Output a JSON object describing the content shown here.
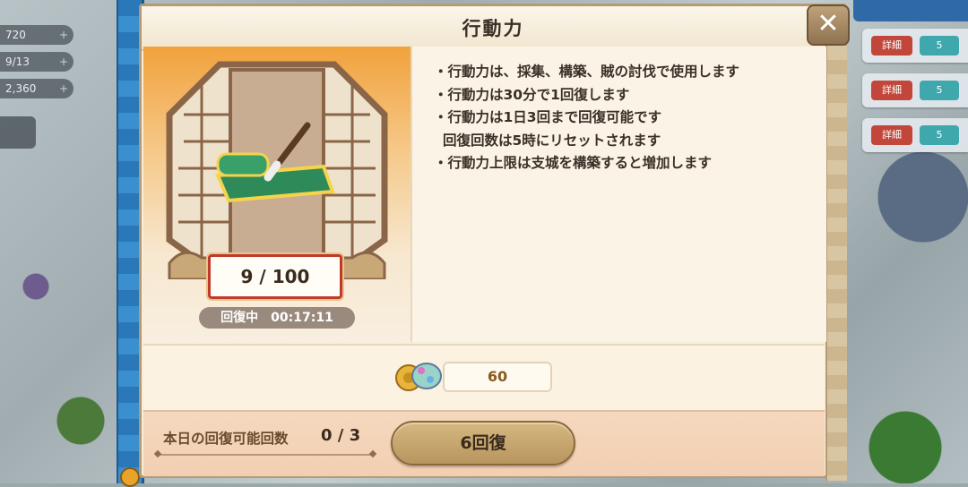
{
  "hud": {
    "resources": [
      "720",
      "9/13",
      "2,360"
    ],
    "plus": "+"
  },
  "right_panel": {
    "cards": [
      {
        "red": "詳細",
        "teal": "5"
      },
      {
        "red": "詳細",
        "teal": "5"
      },
      {
        "red": "詳細",
        "teal": "5"
      }
    ]
  },
  "dialog": {
    "title": "行動力",
    "close_label": "✕",
    "counter": "9 / 100",
    "timer": "回復中　00:17:11",
    "info": [
      "・行動力は、採集、構築、賊の討伐で使用します",
      "・行動力は30分で1回復します",
      "・行動力は1日3回まで回復可能です",
      "回復回数は5時にリセットされます",
      "・行動力上限は支城を構築すると増加します"
    ],
    "cost_value": "60",
    "recover_label": "本日の回復可能回数",
    "recover_count": "0 / 3",
    "recover_button": "6回復"
  },
  "colors": {
    "accent_red": "#c0392b",
    "panel_bg": "#f6eedd",
    "frame_blue": "#2a78b8"
  }
}
